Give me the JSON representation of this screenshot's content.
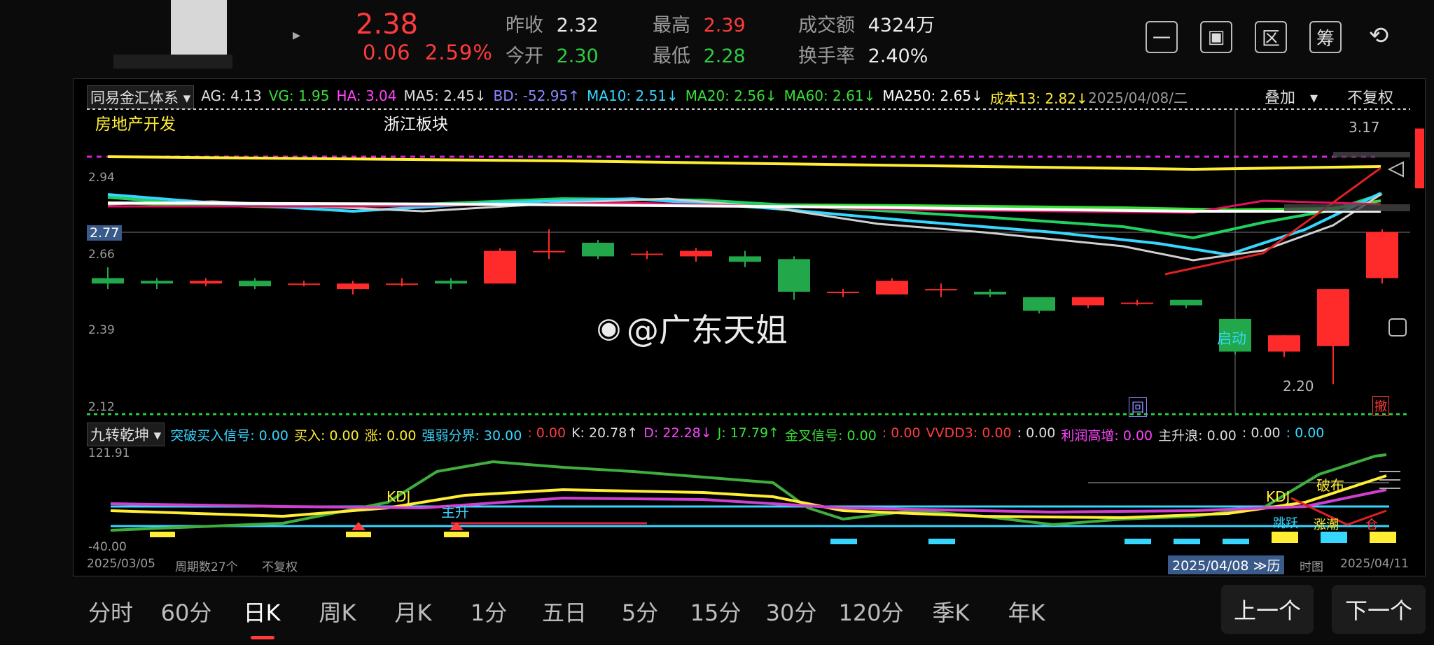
{
  "header": {
    "price": "2.38",
    "change": "0.06",
    "change_pct": "2.59%",
    "prev_close_label": "昨收",
    "prev_close": "2.32",
    "open_label": "今开",
    "open": "2.30",
    "high_label": "最高",
    "high": "2.39",
    "low_label": "最低",
    "low": "2.28",
    "turnover_label": "成交额",
    "turnover": "4324万",
    "turnover_rate_label": "换手率",
    "turnover_rate": "2.40%",
    "toolbar": [
      {
        "name": "minus-icon",
        "glyph": "一"
      },
      {
        "name": "screen-icon",
        "glyph": "▣"
      },
      {
        "name": "region-icon",
        "glyph": "区"
      },
      {
        "name": "chip-icon",
        "glyph": "筹"
      },
      {
        "name": "rotate-icon",
        "glyph": "⟲"
      }
    ]
  },
  "main_chart": {
    "system_select": "同易金汇体系",
    "indicators": [
      {
        "text": "AG: 4.13",
        "color": "#dddddd"
      },
      {
        "text": "VG: 1.95",
        "color": "#38e038"
      },
      {
        "text": "HA: 3.04",
        "color": "#ff44ff"
      },
      {
        "text": "MA5: 2.45↓",
        "color": "#dddddd"
      },
      {
        "text": "BD: -52.95↑",
        "color": "#8a8aff"
      },
      {
        "text": "MA10: 2.51↓",
        "color": "#36d6ff"
      },
      {
        "text": "MA20: 2.56↓",
        "color": "#38e038"
      },
      {
        "text": "MA60: 2.61↓",
        "color": "#38e038"
      },
      {
        "text": "MA250: 2.65↓",
        "color": "#ffffff"
      },
      {
        "text": "成本13: 2.82↓",
        "color": "#ffee33"
      }
    ],
    "date": "2025/04/08/二",
    "overlay_select": "叠加",
    "adjust_select": "不复权",
    "sector_label": "房地产开发",
    "region_label": "浙江板块",
    "y_ticks": [
      "2.94",
      "2.66",
      "2.39",
      "2.12"
    ],
    "crosshair_value": "2.77",
    "max_label": "3.17",
    "min_label": "2.20",
    "start_label": "启动",
    "back_label": "回",
    "marker_label": "撤",
    "watermark": "@广东天姐",
    "ylim": [
      2.12,
      3.2
    ]
  },
  "sub_chart": {
    "indicator_select": "九转乾坤",
    "readouts": [
      {
        "text": "突破买入信号: 0.00",
        "color": "#36d6ff"
      },
      {
        "text": "买入: 0.00",
        "color": "#ffee33"
      },
      {
        "text": "涨: 0.00",
        "color": "#ffee33"
      },
      {
        "text": "强弱分界: 30.00",
        "color": "#36d6ff"
      },
      {
        "text": ": 0.00",
        "color": "#ff3b3b"
      },
      {
        "text": "K: 20.78↑",
        "color": "#dddddd"
      },
      {
        "text": "D: 22.28↓",
        "color": "#ff44ff"
      },
      {
        "text": "J: 17.79↑",
        "color": "#38e038"
      },
      {
        "text": "金叉信号: 0.00",
        "color": "#38e038"
      },
      {
        "text": ": 0.00",
        "color": "#ff3b3b"
      },
      {
        "text": "VVDD3: 0.00",
        "color": "#ff3b3b"
      },
      {
        "text": ": 0.00",
        "color": "#dddddd"
      },
      {
        "text": "利润高增: 0.00",
        "color": "#ff44ff"
      },
      {
        "text": "主升浪: 0.00",
        "color": "#dddddd"
      },
      {
        "text": ": 0.00",
        "color": "#dddddd"
      },
      {
        "text": ": 0.00",
        "color": "#36d6ff"
      }
    ],
    "y_max": "121.91",
    "y_min": "-40.00",
    "labels": {
      "kdj1": "KDJ",
      "zhusheng": "主升",
      "kdj2": "KDJ",
      "pobu": "破布",
      "tiaoyue": "跳跃",
      "zhangchao": "涨潮",
      "cangxian": "仓"
    },
    "ylim": [
      -40,
      121.91
    ]
  },
  "footer_axis": {
    "start_date": "2025/03/05",
    "period_count": "周期数27个",
    "adjust": "不复权",
    "cursor_date": "2025/04/08",
    "cursor_extra": "≫历",
    "cursor_tail": "时图",
    "end_date": "2025/04/11"
  },
  "tabs": [
    "分时",
    "60分",
    "日K",
    "周K",
    "月K",
    "1分",
    "五日",
    "5分",
    "15分",
    "30分",
    "120分",
    "季K",
    "年K"
  ],
  "active_tab": 2,
  "nav": {
    "prev": "上一个",
    "next": "下一个"
  },
  "chart_data": {
    "type": "candlestick",
    "candles": [
      {
        "o": 2.62,
        "c": 2.6,
        "h": 2.66,
        "l": 2.58
      },
      {
        "o": 2.61,
        "c": 2.6,
        "h": 2.62,
        "l": 2.58
      },
      {
        "o": 2.6,
        "c": 2.61,
        "h": 2.62,
        "l": 2.59
      },
      {
        "o": 2.61,
        "c": 2.59,
        "h": 2.62,
        "l": 2.58
      },
      {
        "o": 2.6,
        "c": 2.6,
        "h": 2.61,
        "l": 2.59
      },
      {
        "o": 2.58,
        "c": 2.6,
        "h": 2.61,
        "l": 2.56
      },
      {
        "o": 2.6,
        "c": 2.6,
        "h": 2.62,
        "l": 2.59
      },
      {
        "o": 2.61,
        "c": 2.6,
        "h": 2.62,
        "l": 2.58
      },
      {
        "o": 2.6,
        "c": 2.72,
        "h": 2.73,
        "l": 2.6
      },
      {
        "o": 2.72,
        "c": 2.72,
        "h": 2.8,
        "l": 2.69
      },
      {
        "o": 2.75,
        "c": 2.7,
        "h": 2.76,
        "l": 2.69
      },
      {
        "o": 2.71,
        "c": 2.71,
        "h": 2.72,
        "l": 2.69
      },
      {
        "o": 2.7,
        "c": 2.72,
        "h": 2.73,
        "l": 2.68
      },
      {
        "o": 2.7,
        "c": 2.68,
        "h": 2.72,
        "l": 2.66
      },
      {
        "o": 2.69,
        "c": 2.57,
        "h": 2.7,
        "l": 2.54
      },
      {
        "o": 2.57,
        "c": 2.57,
        "h": 2.58,
        "l": 2.55
      },
      {
        "o": 2.56,
        "c": 2.61,
        "h": 2.62,
        "l": 2.56
      },
      {
        "o": 2.58,
        "c": 2.58,
        "h": 2.6,
        "l": 2.55
      },
      {
        "o": 2.57,
        "c": 2.56,
        "h": 2.58,
        "l": 2.55
      },
      {
        "o": 2.55,
        "c": 2.5,
        "h": 2.55,
        "l": 2.49
      },
      {
        "o": 2.52,
        "c": 2.55,
        "h": 2.55,
        "l": 2.51
      },
      {
        "o": 2.53,
        "c": 2.53,
        "h": 2.54,
        "l": 2.52
      },
      {
        "o": 2.54,
        "c": 2.52,
        "h": 2.54,
        "l": 2.51
      },
      {
        "o": 2.47,
        "c": 2.35,
        "h": 2.47,
        "l": 2.34
      },
      {
        "o": 2.35,
        "c": 2.41,
        "h": 2.41,
        "l": 2.33
      },
      {
        "o": 2.37,
        "c": 2.58,
        "h": 2.58,
        "l": 2.23
      },
      {
        "o": 2.62,
        "c": 2.79,
        "h": 2.8,
        "l": 2.6
      },
      {
        "o": 2.95,
        "c": 3.17,
        "h": 3.17,
        "l": 2.93
      }
    ]
  }
}
